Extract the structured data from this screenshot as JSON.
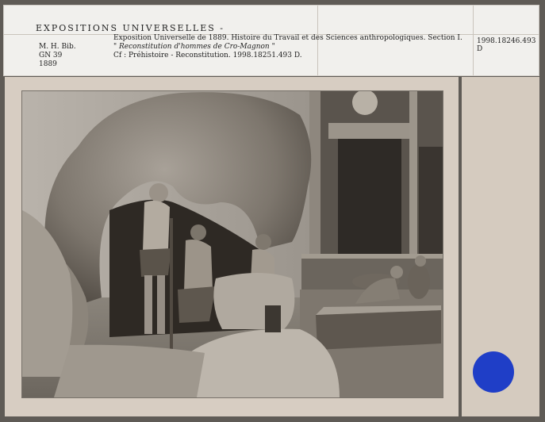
{
  "label": {
    "series_title": "EXPOSITIONS UNIVERSELLES  -",
    "catalogue_number": "1998.18246.493 D",
    "meta": [
      "M. H. Bib.",
      "GN 39",
      "1889"
    ],
    "description": [
      "Exposition Universelle de 1889. Histoire du Travail et des Sciences anthropologiques. Section I.",
      "\" Reconstitution d'hommes de Cro-Magnon \"",
      "Cf : Préhistoire - Reconstitution. 1998.18251.493 D."
    ]
  },
  "photo": {
    "subject": "diorama-cro-magnon-reconstitution"
  },
  "sticker": {
    "color": "#1f3ec7"
  }
}
